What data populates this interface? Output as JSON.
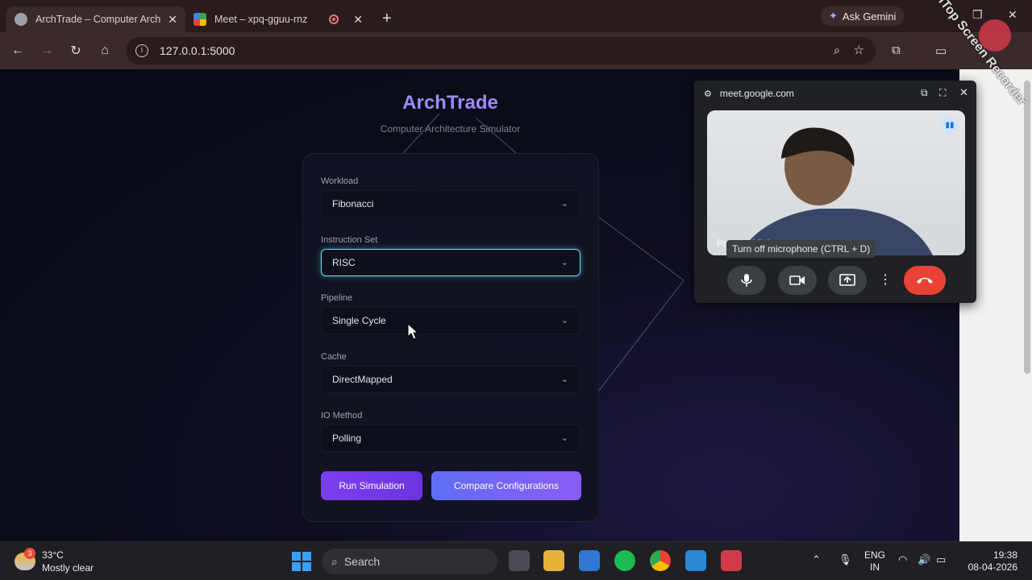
{
  "browser": {
    "tabs": [
      {
        "title": "ArchTrade – Computer Architecture Simulator",
        "active": true
      },
      {
        "title": "Meet – xpq-gguu-rnz",
        "active": false
      }
    ],
    "ask_gemini": "Ask Gemini",
    "url": "127.0.0.1:5000"
  },
  "app": {
    "brand": "ArchTrade",
    "subtitle": "Computer Architecture Simulator",
    "fields": [
      {
        "label": "Workload",
        "value": "Fibonacci"
      },
      {
        "label": "Instruction Set",
        "value": "RISC"
      },
      {
        "label": "Pipeline",
        "value": "Single Cycle"
      },
      {
        "label": "Cache",
        "value": "DirectMapped"
      },
      {
        "label": "IO Method",
        "value": "Polling"
      }
    ],
    "run_button": "Run Simulation",
    "compare_button": "Compare Configurations"
  },
  "meet": {
    "domain": "meet.google.com",
    "participant_name": "Pranjay Mishra",
    "tooltip": "Turn off microphone (CTRL + D)"
  },
  "watermark": "iTop Screen Recorder",
  "taskbar": {
    "temperature": "33°C",
    "condition": "Mostly clear",
    "weather_badge": "3",
    "search_placeholder": "Search",
    "lang_line1": "ENG",
    "lang_line2": "IN",
    "time": "19:38",
    "date": "08-04-2026"
  },
  "colors": {
    "accent": "#7b3ff2",
    "focus": "#6fe0ff",
    "end_call": "#ea4335"
  }
}
